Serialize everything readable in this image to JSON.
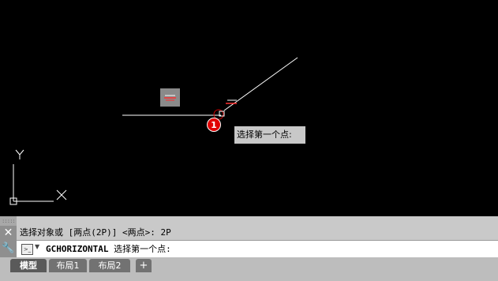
{
  "tooltip": {
    "text": "选择第一个点:"
  },
  "step_badge": {
    "text": "1"
  },
  "ucs": {
    "x_label": "X",
    "y_label": "Y"
  },
  "command_line": {
    "history": "选择对象或 [两点(2P)] <两点>: 2P",
    "command": "GCHORIZONTAL",
    "prompt": " 选择第一个点:"
  },
  "buttons": {
    "close": "✕",
    "customize": "🔧",
    "add_layout": "+"
  },
  "tabs": [
    {
      "label": "模型"
    },
    {
      "label": "布局1"
    },
    {
      "label": "布局2"
    }
  ],
  "colors": {
    "background": "#000000",
    "accent": "#e00000"
  }
}
